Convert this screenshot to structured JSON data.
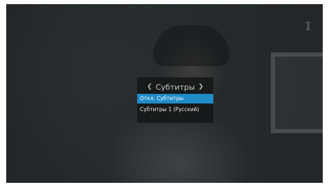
{
  "subtitle_menu": {
    "title": "Субтитры",
    "prev_icon": "chevron-left-icon",
    "next_icon": "chevron-right-icon",
    "items": [
      {
        "label": "Откл. Субтитры",
        "selected": true
      },
      {
        "label": "Субтитры 1 (Русский)",
        "selected": false
      }
    ]
  },
  "colors": {
    "selection": "#1f8cc6",
    "menu_background": "#141618"
  }
}
